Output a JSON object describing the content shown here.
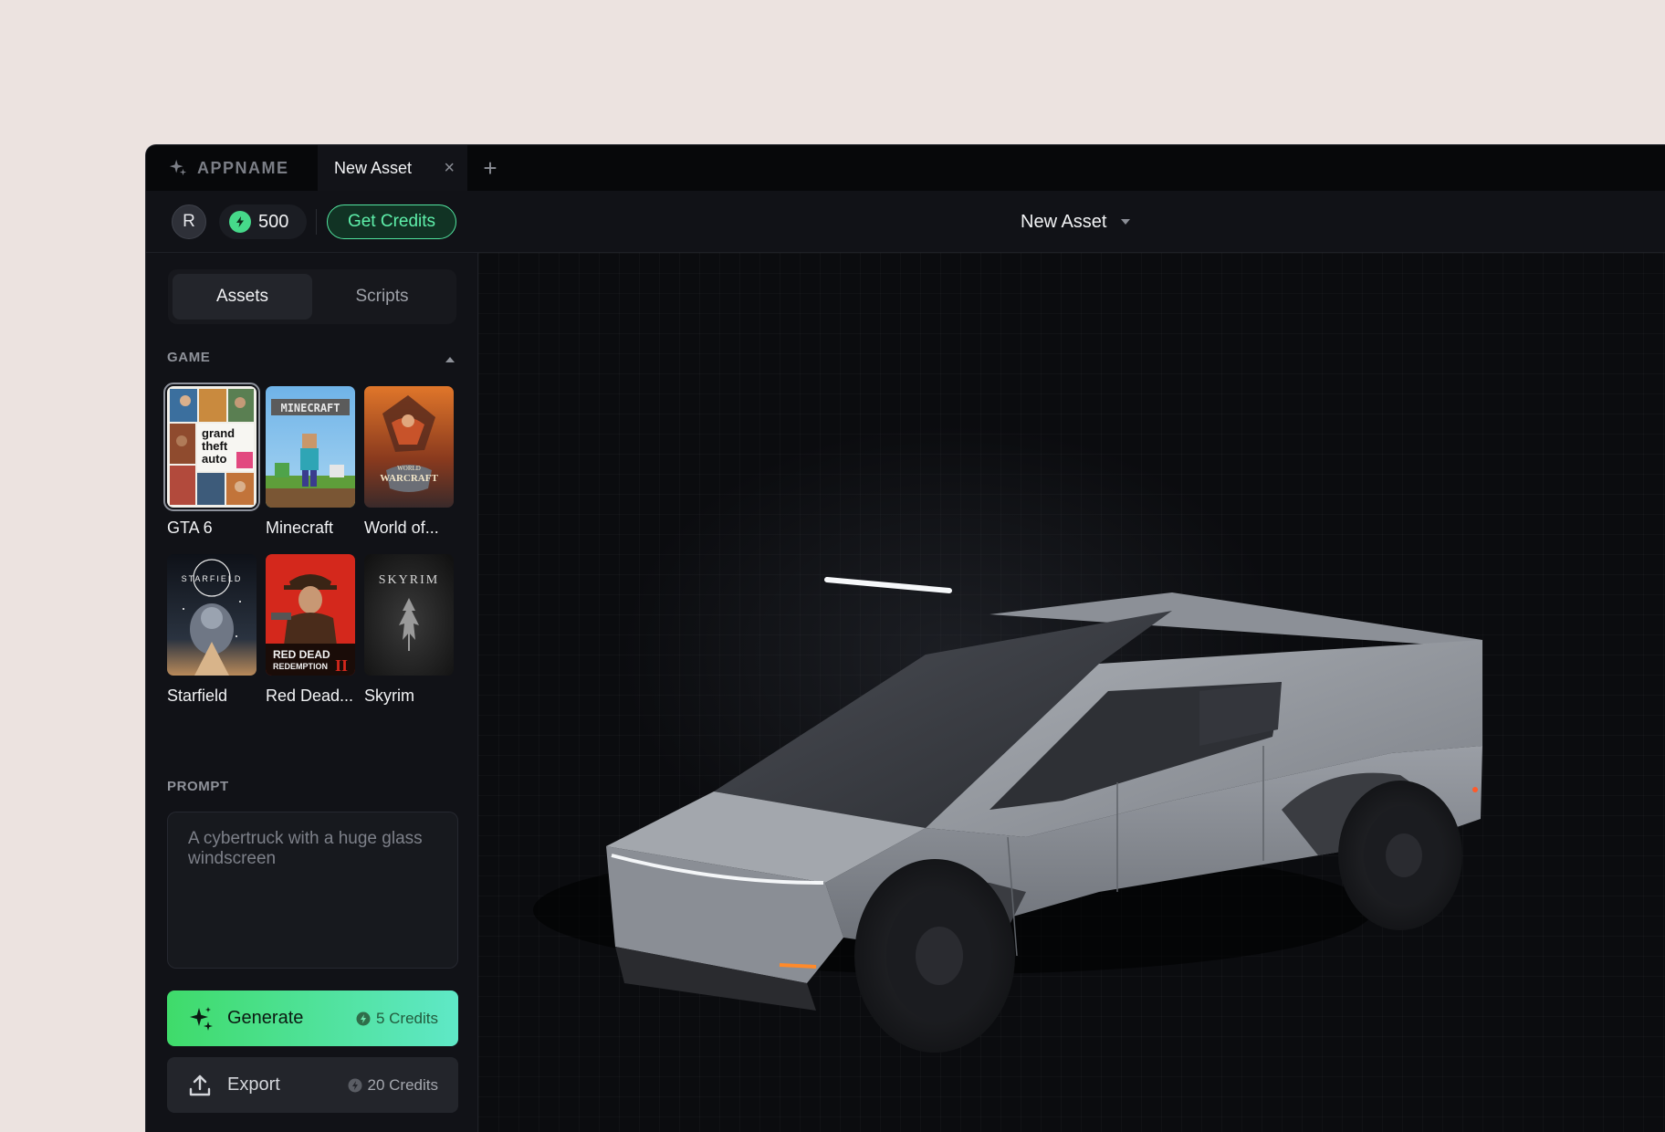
{
  "app": {
    "name": "APPNAME"
  },
  "tabs": [
    {
      "label": "New Asset",
      "active": true
    }
  ],
  "toolbar": {
    "avatar_initial": "R",
    "credits": "500",
    "get_credits_label": "Get Credits",
    "asset_title": "New Asset"
  },
  "sidebar": {
    "segments": [
      {
        "label": "Assets",
        "active": true
      },
      {
        "label": "Scripts",
        "active": false
      }
    ],
    "game_section_label": "GAME",
    "games": [
      {
        "name": "GTA 6",
        "selected": true
      },
      {
        "name": "Minecraft",
        "selected": false
      },
      {
        "name": "World of...",
        "selected": false
      },
      {
        "name": "Starfield",
        "selected": false
      },
      {
        "name": "Red Dead...",
        "selected": false
      },
      {
        "name": "Skyrim",
        "selected": false
      }
    ],
    "prompt_section_label": "PROMPT",
    "prompt_placeholder": "A cybertruck with a huge glass windscreen",
    "generate": {
      "label": "Generate",
      "cost": "5 Credits"
    },
    "export": {
      "label": "Export",
      "cost": "20 Credits"
    }
  },
  "colors": {
    "accent": "#46d98a",
    "accent_gradient_end": "#5fe8c7",
    "background": "#0f1014"
  }
}
